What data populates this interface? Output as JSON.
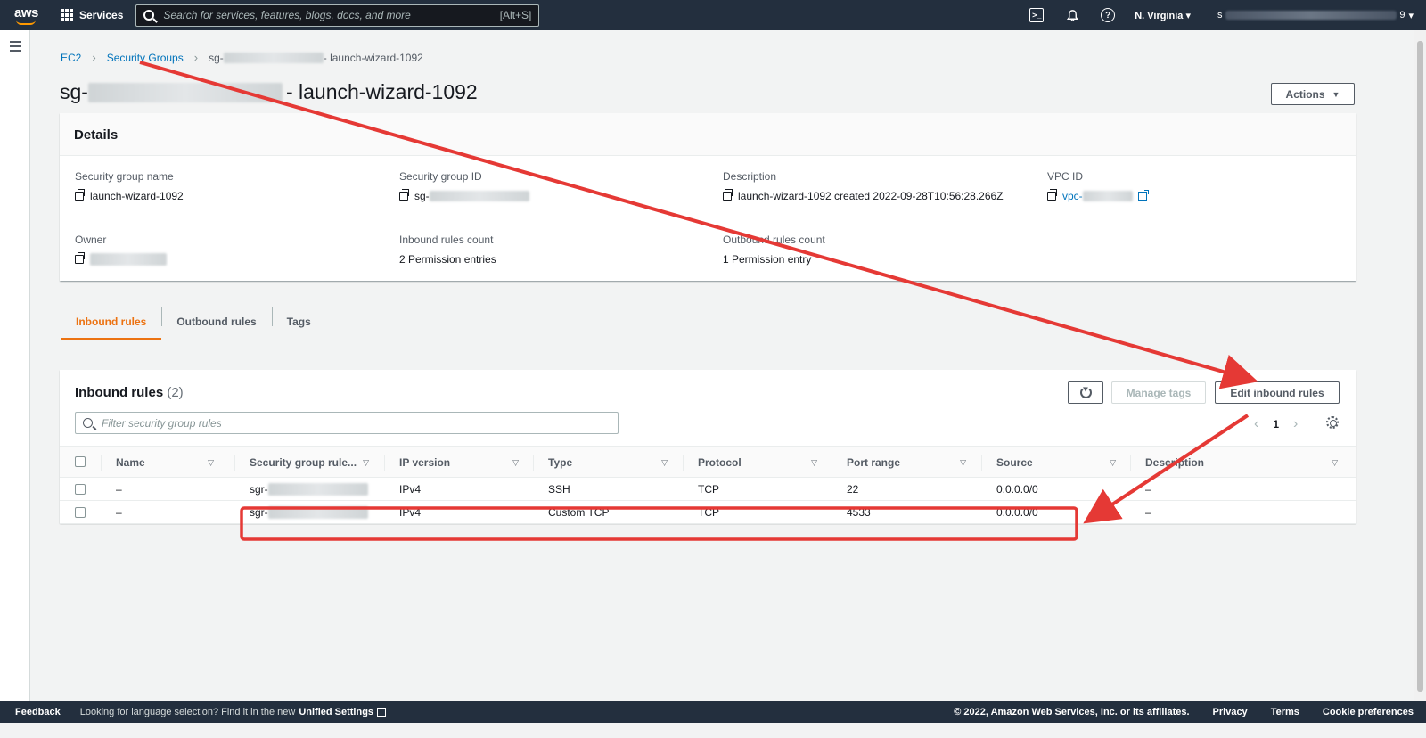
{
  "topnav": {
    "logo_text": "aws",
    "services_label": "Services",
    "search_placeholder": "Search for services, features, blogs, docs, and more",
    "search_shortcut": "[Alt+S]",
    "region": "N. Virginia",
    "account_start": "s",
    "account_end": "9"
  },
  "breadcrumb": {
    "items": [
      "EC2",
      "Security Groups"
    ],
    "current_prefix": "sg-",
    "current_suffix": "- launch-wizard-1092"
  },
  "page": {
    "title_prefix": "sg-",
    "title_suffix": "- launch-wizard-1092",
    "actions_label": "Actions"
  },
  "details": {
    "heading": "Details",
    "fields": {
      "sg_name": {
        "label": "Security group name",
        "value": "launch-wizard-1092"
      },
      "sg_id": {
        "label": "Security group ID",
        "value": "sg-"
      },
      "description": {
        "label": "Description",
        "value": "launch-wizard-1092 created 2022-09-28T10:56:28.266Z"
      },
      "vpc_id": {
        "label": "VPC ID",
        "value": "vpc-"
      },
      "owner": {
        "label": "Owner",
        "value": ""
      },
      "inbound_count": {
        "label": "Inbound rules count",
        "value": "2 Permission entries"
      },
      "outbound_count": {
        "label": "Outbound rules count",
        "value": "1 Permission entry"
      }
    }
  },
  "tabs": [
    "Inbound rules",
    "Outbound rules",
    "Tags"
  ],
  "inbound": {
    "heading": "Inbound rules",
    "count": "(2)",
    "manage_tags_label": "Manage tags",
    "edit_label": "Edit inbound rules",
    "filter_placeholder": "Filter security group rules",
    "page_number": "1",
    "columns": [
      "Name",
      "Security group rule...",
      "IP version",
      "Type",
      "Protocol",
      "Port range",
      "Source",
      "Description"
    ],
    "rows": [
      {
        "name": "–",
        "rule_id": "sgr-",
        "ip_version": "IPv4",
        "type": "SSH",
        "protocol": "TCP",
        "port_range": "22",
        "source": "0.0.0.0/0",
        "description": "–"
      },
      {
        "name": "–",
        "rule_id": "sgr-",
        "ip_version": "IPv4",
        "type": "Custom TCP",
        "protocol": "TCP",
        "port_range": "4533",
        "source": "0.0.0.0/0",
        "description": "–"
      }
    ]
  },
  "footer": {
    "feedback": "Feedback",
    "language_msg": "Looking for language selection? Find it in the new",
    "unified_settings": "Unified Settings",
    "copyright": "© 2022, Amazon Web Services, Inc. or its affiliates.",
    "links": [
      "Privacy",
      "Terms",
      "Cookie preferences"
    ]
  },
  "colors": {
    "nav_bg": "#232f3e",
    "link": "#0073bb",
    "active_tab": "#ec7211",
    "annotation": "#e53935"
  }
}
